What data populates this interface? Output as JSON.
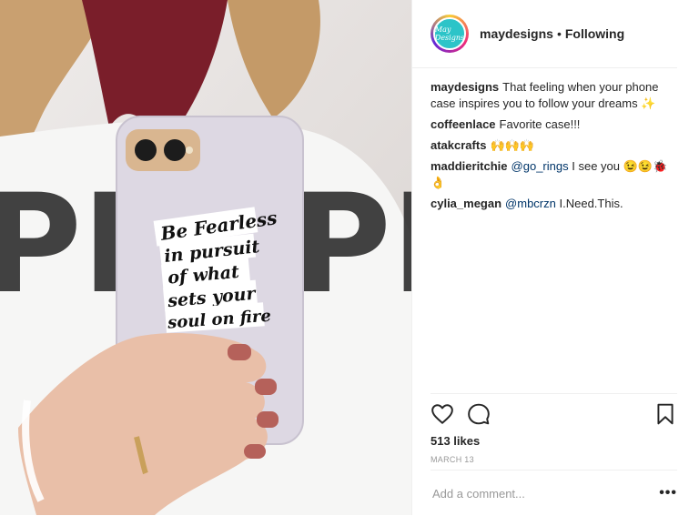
{
  "post": {
    "username": "maydesigns",
    "follow_status": "Following",
    "avatar_text": "May Designs",
    "case_text": [
      "Be Fearless",
      "in pursuit",
      "of what",
      "sets your",
      "soul on fire"
    ]
  },
  "comments": [
    {
      "user": "maydesigns",
      "mention": "",
      "text": "That feeling when your phone case inspires you to follow your dreams ✨"
    },
    {
      "user": "coffeenlace",
      "mention": "",
      "text": "Favorite case!!!"
    },
    {
      "user": "atakcrafts",
      "mention": "",
      "text": "🙌🙌🙌"
    },
    {
      "user": "maddieritchie",
      "mention": "@go_rings",
      "text": "I see you 😉😉🐞 👌"
    },
    {
      "user": "cylia_megan",
      "mention": "@mbcrzn",
      "text": "I.Need.This."
    }
  ],
  "likes": "513 likes",
  "date": "MARCH 13",
  "add_comment_placeholder": "Add a comment...",
  "more_label": "•••",
  "icons": {
    "like": "heart-icon",
    "comment": "comment-icon",
    "save": "bookmark-icon",
    "more": "more-options-icon"
  },
  "colors": {
    "username": "#262626",
    "mention": "#003569",
    "muted": "#999999",
    "avatar": "#2cc4c8"
  }
}
